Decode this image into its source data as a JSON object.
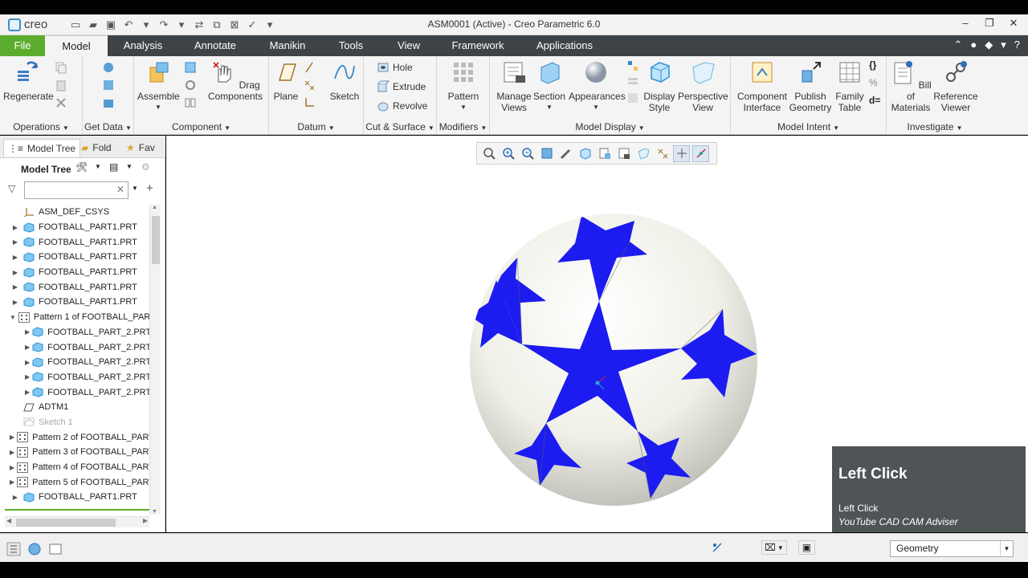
{
  "app": {
    "logo_text": "creo",
    "window_title": "ASM0001 (Active) - Creo Parametric 6.0"
  },
  "tabs": [
    {
      "label": "File"
    },
    {
      "label": "Model"
    },
    {
      "label": "Analysis"
    },
    {
      "label": "Annotate"
    },
    {
      "label": "Manikin"
    },
    {
      "label": "Tools"
    },
    {
      "label": "View"
    },
    {
      "label": "Framework"
    },
    {
      "label": "Applications"
    }
  ],
  "active_tab": "Model",
  "ribbon": {
    "operations": {
      "label": "Operations",
      "regenerate": "Regenerate"
    },
    "get_data": {
      "label": "Get Data"
    },
    "component": {
      "label": "Component",
      "assemble": "Assemble",
      "drag": "Drag\nComponents"
    },
    "datum": {
      "label": "Datum",
      "plane": "Plane",
      "sketch": "Sketch"
    },
    "cut_surface": {
      "label": "Cut & Surface",
      "hole": "Hole",
      "extrude": "Extrude",
      "revolve": "Revolve"
    },
    "modifiers": {
      "label": "Modifiers",
      "pattern": "Pattern"
    },
    "model_display": {
      "label": "Model Display",
      "manage_views": "Manage\nViews",
      "section": "Section",
      "appearances": "Appearances",
      "display_style": "Display\nStyle",
      "perspective_view": "Perspective\nView"
    },
    "model_intent": {
      "label": "Model Intent",
      "component_interface": "Component\nInterface",
      "publish_geometry": "Publish\nGeometry",
      "family_table": "Family\nTable",
      "d_equals": "d="
    },
    "investigate": {
      "label": "Investigate",
      "bill_of_materials": "Bill of\nMaterials",
      "reference_viewer": "Reference\nViewer"
    }
  },
  "left_panel": {
    "tabs": [
      "Model Tree",
      "Fold",
      "Fav"
    ],
    "toolbar_title": "Model Tree",
    "filter_placeholder": "",
    "tree": [
      {
        "label": "ASM_DEF_CSYS",
        "level": 0,
        "expander": "",
        "icon": "csys-icon"
      },
      {
        "label": "FOOTBALL_PART1.PRT",
        "level": 0,
        "expander": "▶",
        "icon": "part-icon"
      },
      {
        "label": "FOOTBALL_PART1.PRT",
        "level": 0,
        "expander": "▶",
        "icon": "part-icon"
      },
      {
        "label": "FOOTBALL_PART1.PRT",
        "level": 0,
        "expander": "▶",
        "icon": "part-icon"
      },
      {
        "label": "FOOTBALL_PART1.PRT",
        "level": 0,
        "expander": "▶",
        "icon": "part-icon"
      },
      {
        "label": "FOOTBALL_PART1.PRT",
        "level": 0,
        "expander": "▶",
        "icon": "part-icon"
      },
      {
        "label": "FOOTBALL_PART1.PRT",
        "level": 0,
        "expander": "▶",
        "icon": "part-icon"
      },
      {
        "label": "Pattern 1 of FOOTBALL_PART",
        "level": 0,
        "expander": "▼",
        "icon": "pattern-icon"
      },
      {
        "label": "FOOTBALL_PART_2.PRT",
        "level": 1,
        "expander": "▶",
        "icon": "part-icon"
      },
      {
        "label": "FOOTBALL_PART_2.PRT",
        "level": 1,
        "expander": "▶",
        "icon": "part-icon"
      },
      {
        "label": "FOOTBALL_PART_2.PRT",
        "level": 1,
        "expander": "▶",
        "icon": "part-icon"
      },
      {
        "label": "FOOTBALL_PART_2.PRT",
        "level": 1,
        "expander": "▶",
        "icon": "part-icon"
      },
      {
        "label": "FOOTBALL_PART_2.PRT",
        "level": 1,
        "expander": "▶",
        "icon": "part-icon"
      },
      {
        "label": "ADTM1",
        "level": 0,
        "expander": "",
        "icon": "datum-plane-icon"
      },
      {
        "label": "Sketch 1",
        "level": 0,
        "expander": "",
        "icon": "sketch-icon",
        "dim": true
      },
      {
        "label": "Pattern 2 of FOOTBALL_PART",
        "level": 0,
        "expander": "▶",
        "icon": "pattern-icon"
      },
      {
        "label": "Pattern 3 of FOOTBALL_PART",
        "level": 0,
        "expander": "▶",
        "icon": "pattern-icon"
      },
      {
        "label": "Pattern 4 of FOOTBALL_PART",
        "level": 0,
        "expander": "▶",
        "icon": "pattern-icon"
      },
      {
        "label": "Pattern 5 of FOOTBALL_PART",
        "level": 0,
        "expander": "▶",
        "icon": "pattern-icon"
      },
      {
        "label": "FOOTBALL_PART1.PRT",
        "level": 0,
        "expander": "▶",
        "icon": "part-icon"
      }
    ]
  },
  "overlay": {
    "title": "Left Click",
    "line1": "Left Click",
    "line2": "YouTube CAD CAM Adviser"
  },
  "status": {
    "filter_value": "Geometry"
  },
  "colors": {
    "file_tab": "#5cac2d",
    "tabbar": "#3d4347",
    "ball_blue": "#1a1aee",
    "ball_white": "#f2f2ea"
  }
}
